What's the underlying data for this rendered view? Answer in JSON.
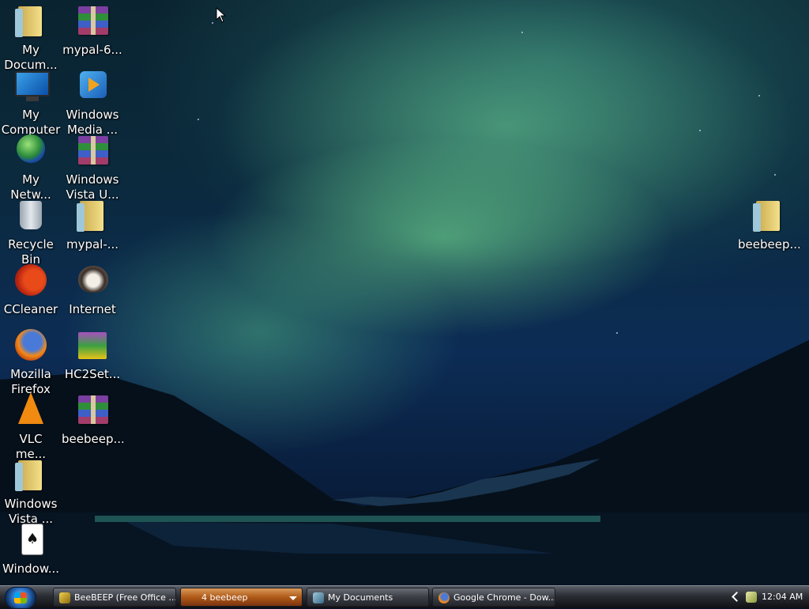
{
  "desktop": {
    "icons": [
      {
        "label": "My\nDocum...",
        "icon": "documents-folder-icon"
      },
      {
        "label": "My\nComputer",
        "icon": "computer-icon"
      },
      {
        "label": "My\nNetw...",
        "icon": "network-icon"
      },
      {
        "label": "Recycle\nBin",
        "icon": "recycle-bin-icon"
      },
      {
        "label": "CCleaner",
        "icon": "ccleaner-icon"
      },
      {
        "label": "Mozilla\nFirefox",
        "icon": "firefox-icon"
      },
      {
        "label": "VLC\nme...",
        "icon": "vlc-icon"
      },
      {
        "label": "Windows\nVista ...",
        "icon": "folder-icon"
      },
      {
        "label": "Window...",
        "icon": "solitaire-card-icon"
      },
      {
        "label": "mypal-6...",
        "icon": "winrar-archive-icon"
      },
      {
        "label": "Windows\nMedia ...",
        "icon": "windows-media-player-icon"
      },
      {
        "label": "Windows\nVista U...",
        "icon": "winrar-archive-icon"
      },
      {
        "label": "mypal-...",
        "icon": "folder-icon"
      },
      {
        "label": "Internet",
        "icon": "raccoon-icon"
      },
      {
        "label": "HC2Set...",
        "icon": "installer-icon"
      },
      {
        "label": "beebeep...",
        "icon": "winrar-archive-icon"
      },
      {
        "label": "beebeep...",
        "icon": "folder-icon"
      }
    ]
  },
  "taskbar": {
    "start_button": "windows-orb-icon",
    "tasks": [
      {
        "label": "BeeBEEP (Free Office ...",
        "icon": "beebeep-icon"
      },
      {
        "label": "4  beebeep",
        "icon": "folder-group-icon"
      },
      {
        "label": "My Documents",
        "icon": "folder-window-icon"
      },
      {
        "label": "Google Chrome - Dow...",
        "icon": "firefox-icon"
      }
    ],
    "clock": "12:04 AM"
  },
  "colors": {
    "aurora": "#5ad89a",
    "taskbar": "#2a2d33",
    "group_task": "#b05a18"
  }
}
